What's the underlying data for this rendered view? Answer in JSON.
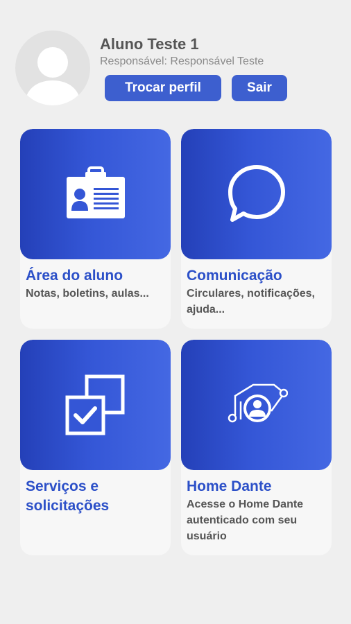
{
  "profile": {
    "name": "Aluno Teste 1",
    "role": "Responsável: Responsável Teste",
    "switch_label": "Trocar perfil",
    "exit_label": "Sair"
  },
  "cards": [
    {
      "title": "Área do aluno",
      "desc": "Notas, boletins, aulas...",
      "icon": "id-card-icon"
    },
    {
      "title": "Comunicação",
      "desc": "Circulares, notificações, ajuda...",
      "icon": "chat-bubble-icon"
    },
    {
      "title": "Serviços e solicitações",
      "desc": "",
      "icon": "checkbox-windows-icon"
    },
    {
      "title": "Home Dante",
      "desc": "Acesse o Home Dante autenticado com seu usuário",
      "icon": "user-network-icon"
    }
  ],
  "colors": {
    "accent": "#3d5fcf",
    "title": "#2c50c8",
    "background": "#efefef"
  }
}
